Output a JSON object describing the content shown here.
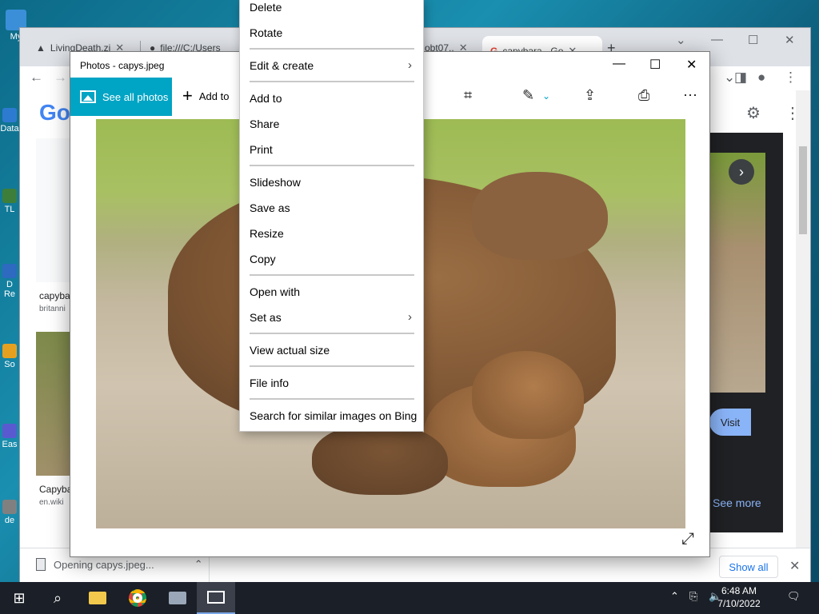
{
  "desktop": {
    "icons": [
      {
        "label": "My"
      },
      {
        "label": "Data"
      },
      {
        "label": "TL"
      },
      {
        "label": "D Re"
      },
      {
        "label": "So"
      },
      {
        "label": "Eas"
      },
      {
        "label": "de"
      }
    ]
  },
  "browser": {
    "tabs": [
      {
        "label": "LivingDeath.zi"
      },
      {
        "label": "file:///C:/Users"
      },
      {
        "label": "obt07.."
      },
      {
        "label": "capybara - Go"
      }
    ],
    "new_tab": "+",
    "logo": "Go",
    "results": [
      {
        "title": "capyba",
        "source": "britanni"
      },
      {
        "title": "Capyba",
        "source": "en.wiki"
      }
    ],
    "visit_label": "Visit",
    "see_more_label": "See more",
    "download": {
      "filename": "Opening capys.jpeg...",
      "show_all_label": "Show all"
    }
  },
  "photos": {
    "title": "Photos - capys.jpeg",
    "see_all_label": "See all photos",
    "add_to_label": "Add to"
  },
  "context_menu": {
    "items": [
      "Delete",
      "Rotate",
      "Edit & create",
      "Add to",
      "Share",
      "Print",
      "Slideshow",
      "Save as",
      "Resize",
      "Copy",
      "Open with",
      "Set as",
      "View actual size",
      "File info",
      "Search for similar images on Bing"
    ]
  },
  "taskbar": {
    "time": "6:48 AM",
    "date": "7/10/2022"
  }
}
